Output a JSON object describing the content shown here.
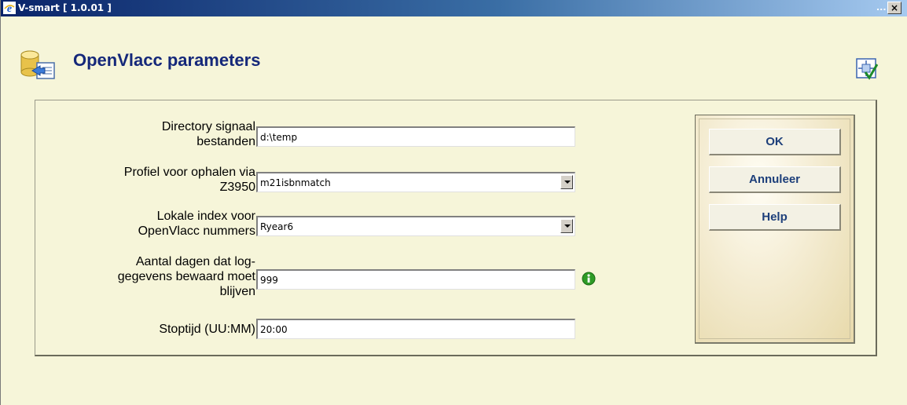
{
  "window": {
    "title": "V-smart [ 1.0.01 ]",
    "minimize_label": "...",
    "close_label": "×"
  },
  "header": {
    "title": "OpenVlacc parameters"
  },
  "form": {
    "fields": [
      {
        "label_line1": "Directory signaal",
        "label_line2": "bestanden",
        "value": "d:\\temp",
        "type": "text"
      },
      {
        "label_line1": "Profiel voor ophalen via",
        "label_line2": "Z3950",
        "value": "m21isbnmatch",
        "type": "select"
      },
      {
        "label_line1": "Lokale index voor",
        "label_line2": "OpenVlacc nummers",
        "value": "Ryear6",
        "type": "select"
      },
      {
        "label_line1": "Aantal dagen dat log-",
        "label_line2": "gegevens bewaard moet",
        "label_line3": "blijven",
        "value": "999",
        "type": "text"
      },
      {
        "label_line1": "Stoptijd (UU:MM)",
        "value": "20:00",
        "type": "text"
      }
    ]
  },
  "buttons": {
    "ok": "OK",
    "cancel": "Annuleer",
    "help": "Help"
  },
  "colors": {
    "title_text": "#15287a",
    "background": "#f6f5d9",
    "button_text": "#1d3f7a",
    "titlebar_start": "#0a246a",
    "titlebar_end": "#a6caf0"
  },
  "icons": [
    "ie-icon",
    "database-import-icon",
    "tool-check-icon",
    "info-icon",
    "dropdown-arrow-icon"
  ]
}
